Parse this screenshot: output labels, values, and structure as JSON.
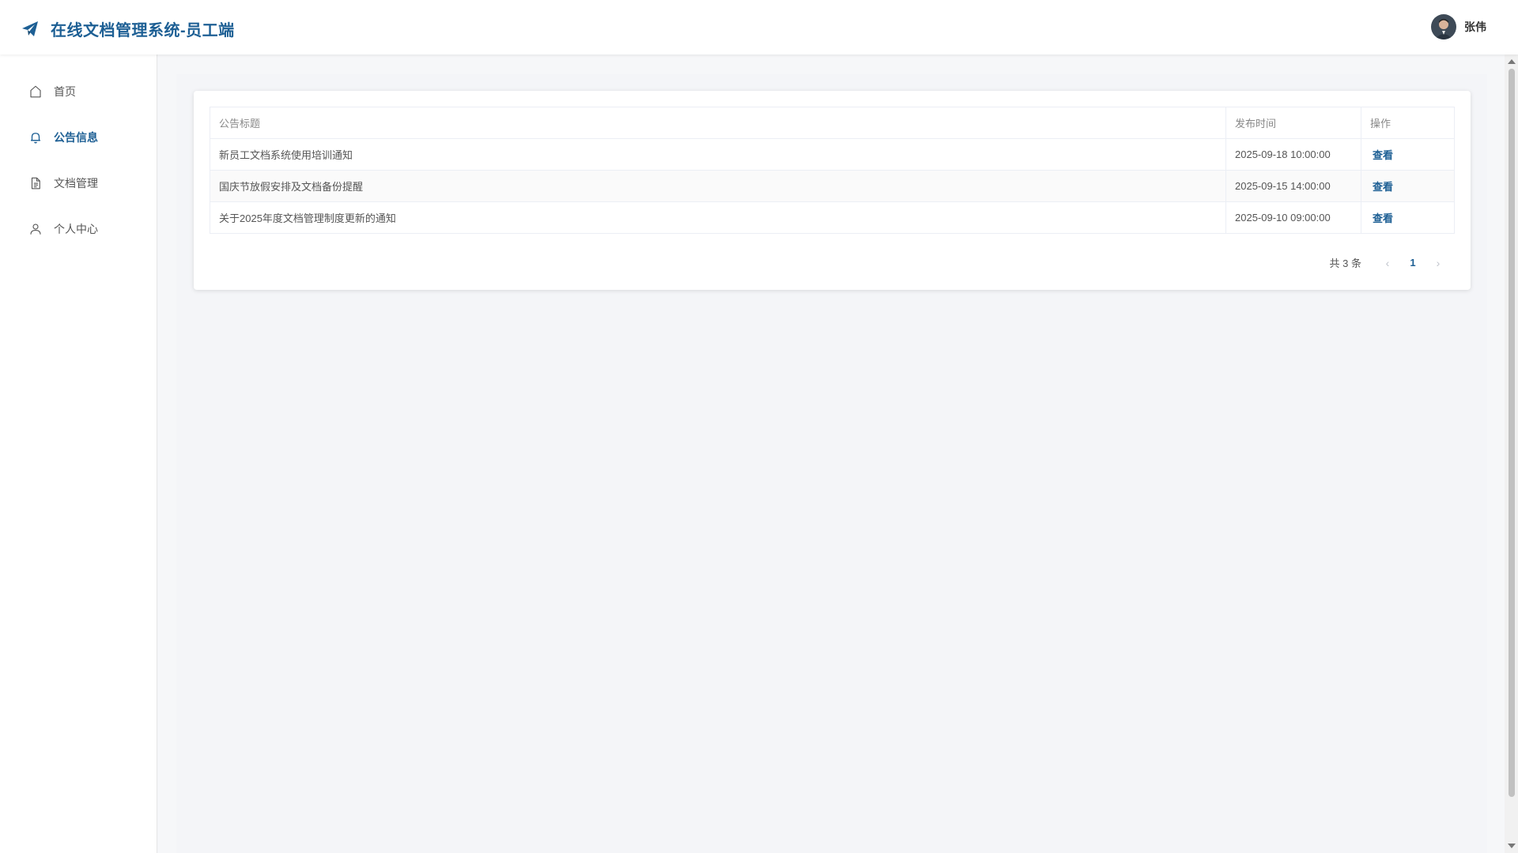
{
  "header": {
    "title": "在线文档管理系统-员工端",
    "user_name": "张伟"
  },
  "sidebar": {
    "items": [
      {
        "label": "首页",
        "icon": "home-icon",
        "active": false
      },
      {
        "label": "公告信息",
        "icon": "bell-icon",
        "active": true
      },
      {
        "label": "文档管理",
        "icon": "document-icon",
        "active": false
      },
      {
        "label": "个人中心",
        "icon": "user-icon",
        "active": false
      }
    ]
  },
  "table": {
    "columns": [
      "公告标题",
      "发布时间",
      "操作"
    ],
    "rows": [
      {
        "title": "新员工文档系统使用培训通知",
        "time": "2025-09-18 10:00:00",
        "action": "查看"
      },
      {
        "title": "国庆节放假安排及文档备份提醒",
        "time": "2025-09-15 14:00:00",
        "action": "查看"
      },
      {
        "title": "关于2025年度文档管理制度更新的通知",
        "time": "2025-09-10 09:00:00",
        "action": "查看"
      }
    ]
  },
  "pagination": {
    "total_text": "共 3 条",
    "current_page": "1",
    "prev_icon": "chevron-left-icon",
    "next_icon": "chevron-right-icon"
  },
  "colors": {
    "brand": "#1d5f94",
    "background": "#f4f5f8"
  }
}
